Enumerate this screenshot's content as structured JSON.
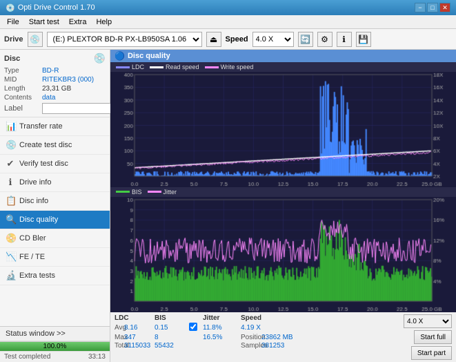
{
  "app": {
    "title": "Opti Drive Control 1.70",
    "title_icon": "💿"
  },
  "title_buttons": {
    "minimize": "−",
    "maximize": "□",
    "close": "✕"
  },
  "menu": {
    "items": [
      "File",
      "Start test",
      "Extra",
      "Help"
    ]
  },
  "toolbar": {
    "drive_label": "Drive",
    "drive_value": "(E:)  PLEXTOR BD-R  PX-LB950SA 1.06",
    "speed_label": "Speed",
    "speed_value": "4.0 X"
  },
  "disc": {
    "section_title": "Disc",
    "type_label": "Type",
    "type_value": "BD-R",
    "mid_label": "MID",
    "mid_value": "RITEKBR3 (000)",
    "length_label": "Length",
    "length_value": "23,31 GB",
    "contents_label": "Contents",
    "contents_value": "data",
    "label_label": "Label",
    "label_value": ""
  },
  "nav": {
    "items": [
      {
        "id": "transfer-rate",
        "label": "Transfer rate",
        "icon": "📊"
      },
      {
        "id": "create-test",
        "label": "Create test disc",
        "icon": "💿"
      },
      {
        "id": "verify-disc",
        "label": "Verify test disc",
        "icon": "✔"
      },
      {
        "id": "drive-info",
        "label": "Drive info",
        "icon": "ℹ"
      },
      {
        "id": "disc-info",
        "label": "Disc info",
        "icon": "📋"
      },
      {
        "id": "disc-quality",
        "label": "Disc quality",
        "icon": "🔍",
        "active": true
      },
      {
        "id": "cd-bler",
        "label": "CD Bler",
        "icon": "📀"
      },
      {
        "id": "fe-te",
        "label": "FE / TE",
        "icon": "📉"
      },
      {
        "id": "extra-tests",
        "label": "Extra tests",
        "icon": "🔬"
      }
    ]
  },
  "chart_header": {
    "title": "Disc quality",
    "icon": "🔵"
  },
  "top_chart": {
    "legends": [
      {
        "label": "LDC",
        "color": "#8888ff"
      },
      {
        "label": "Read speed",
        "color": "#ffffff"
      },
      {
        "label": "Write speed",
        "color": "#ff88ff"
      }
    ],
    "y_axis_left": [
      "400",
      "350",
      "300",
      "250",
      "200",
      "150",
      "100",
      "50"
    ],
    "y_axis_right": [
      "18X",
      "16X",
      "14X",
      "12X",
      "10X",
      "8X",
      "6X",
      "4X",
      "2X"
    ],
    "x_axis": [
      "0.0",
      "2.5",
      "5.0",
      "7.5",
      "10.0",
      "12.5",
      "15.0",
      "17.5",
      "20.0",
      "22.5",
      "25.0 GB"
    ]
  },
  "bottom_chart": {
    "legends": [
      {
        "label": "BIS",
        "color": "#88ff88"
      },
      {
        "label": "Jitter",
        "color": "#ff88ff"
      }
    ],
    "y_axis_left": [
      "10",
      "9",
      "8",
      "7",
      "6",
      "5",
      "4",
      "3",
      "2",
      "1"
    ],
    "y_axis_right": [
      "20%",
      "16%",
      "12%",
      "8%",
      "4%"
    ],
    "x_axis": [
      "0.0",
      "2.5",
      "5.0",
      "7.5",
      "10.0",
      "12.5",
      "15.0",
      "17.5",
      "20.0",
      "22.5",
      "25.0 GB"
    ]
  },
  "stats": {
    "col_headers": [
      "LDC",
      "BIS",
      "",
      "Jitter",
      "Speed",
      ""
    ],
    "avg_label": "Avg",
    "avg_ldc": "8.16",
    "avg_bis": "0.15",
    "avg_jitter": "11.8%",
    "avg_speed": "4.19 X",
    "avg_speed_select": "4.0 X",
    "max_label": "Max",
    "max_ldc": "347",
    "max_bis": "8",
    "max_jitter": "16.5%",
    "pos_label": "Position",
    "pos_value": "23862 MB",
    "total_label": "Total",
    "total_ldc": "3115033",
    "total_bis": "55432",
    "samples_label": "Samples",
    "samples_value": "381253",
    "jitter_checked": true,
    "jitter_label": "Jitter",
    "start_full_label": "Start full",
    "start_part_label": "Start part"
  },
  "status": {
    "window_label": "Status window >>",
    "progress_pct": 100,
    "progress_text": "100.0%",
    "completed_text": "Test completed",
    "time_text": "33:13"
  },
  "colors": {
    "accent_blue": "#1e7bc4",
    "chart_bg": "#1a1a3a",
    "ldc_color": "#8888ff",
    "bis_color": "#44cc44",
    "jitter_color": "#ff88ff",
    "read_speed_color": "#ffffff",
    "grid_color": "#2a2a6a",
    "progress_green": "#3a9a3a"
  }
}
